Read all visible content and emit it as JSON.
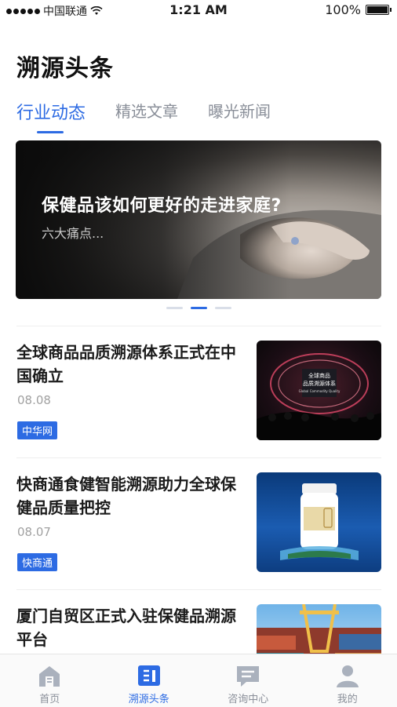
{
  "status": {
    "carrier": "中国联通",
    "time": "1:21 AM",
    "battery": "100%"
  },
  "page": {
    "title": "溯源头条"
  },
  "tabs": [
    {
      "label": "行业动态"
    },
    {
      "label": "精选文章"
    },
    {
      "label": "曝光新闻"
    }
  ],
  "banner": {
    "title": "保健品该如何更好的走进家庭?",
    "subtitle": "六大痛点..."
  },
  "news": [
    {
      "title": "全球商品品质溯源体系正式在中国确立",
      "date": "08.08",
      "source": "中华网"
    },
    {
      "title": "快商通食健智能溯源助力全球保健品质量把控",
      "date": "08.07",
      "source": "快商通"
    },
    {
      "title": "厦门自贸区正式入驻保健品溯源平台",
      "date": "",
      "source": ""
    }
  ],
  "thumb_text": {
    "stage_line1": "全球商品",
    "stage_line2": "品质溯源体系",
    "stage_line3": "Global Commodity Quality"
  },
  "nav": [
    {
      "label": "首页",
      "icon": "home-icon"
    },
    {
      "label": "溯源头条",
      "icon": "news-icon"
    },
    {
      "label": "咨询中心",
      "icon": "chat-icon"
    },
    {
      "label": "我的",
      "icon": "user-icon"
    }
  ],
  "colors": {
    "accent": "#2d6be3",
    "inactive": "#8a8f99"
  }
}
